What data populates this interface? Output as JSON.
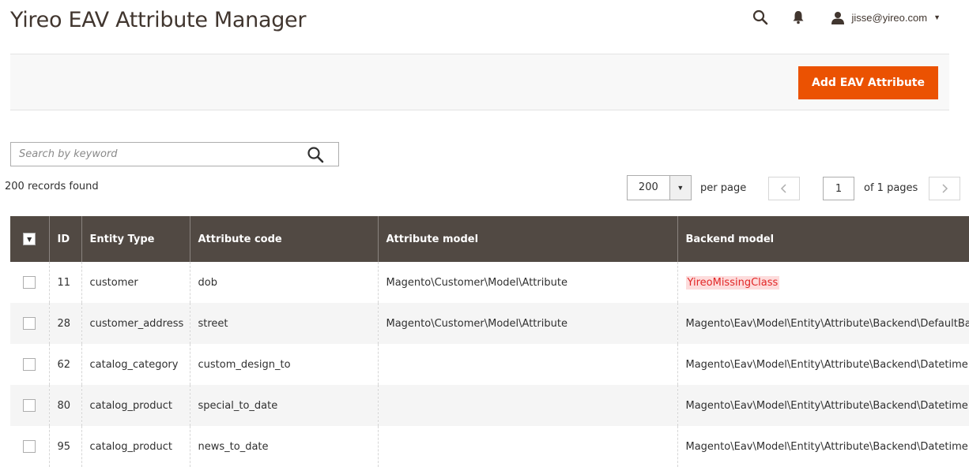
{
  "header": {
    "title": "Yireo EAV Attribute Manager",
    "user": "jisse@yireo.com"
  },
  "actions": {
    "add_label": "Add EAV Attribute"
  },
  "search": {
    "placeholder": "Search by keyword",
    "value": ""
  },
  "toolbar": {
    "records_found": "200 records found",
    "per_page_value": "200",
    "per_page_label": "per page",
    "current_page": "1",
    "pages_label": "of 1 pages"
  },
  "colors": {
    "accent": "#eb5202",
    "header_bg": "#514943",
    "error_bg": "#fddcdc",
    "error_text": "#e22626"
  },
  "icons": {
    "search": "search-icon",
    "bell": "bell-icon",
    "user": "user-icon",
    "caret": "caret-down-icon",
    "prev": "chevron-left-icon",
    "next": "chevron-right-icon"
  },
  "grid": {
    "columns": [
      "ID",
      "Entity Type",
      "Attribute code",
      "Attribute model",
      "Backend model"
    ],
    "rows": [
      {
        "id": "11",
        "entity_type": "customer",
        "attribute_code": "dob",
        "attribute_model": "Magento\\Customer\\Model\\Attribute",
        "backend_model": "YireoMissingClass",
        "backend_missing": true
      },
      {
        "id": "28",
        "entity_type": "customer_address",
        "attribute_code": "street",
        "attribute_model": "Magento\\Customer\\Model\\Attribute",
        "backend_model": "Magento\\Eav\\Model\\Entity\\Attribute\\Backend\\DefaultBackend",
        "backend_missing": false
      },
      {
        "id": "62",
        "entity_type": "catalog_category",
        "attribute_code": "custom_design_to",
        "attribute_model": "",
        "backend_model": "Magento\\Eav\\Model\\Entity\\Attribute\\Backend\\Datetime",
        "backend_missing": false
      },
      {
        "id": "80",
        "entity_type": "catalog_product",
        "attribute_code": "special_to_date",
        "attribute_model": "",
        "backend_model": "Magento\\Eav\\Model\\Entity\\Attribute\\Backend\\Datetime",
        "backend_missing": false
      },
      {
        "id": "95",
        "entity_type": "catalog_product",
        "attribute_code": "news_to_date",
        "attribute_model": "",
        "backend_model": "Magento\\Eav\\Model\\Entity\\Attribute\\Backend\\Datetime",
        "backend_missing": false
      }
    ]
  }
}
